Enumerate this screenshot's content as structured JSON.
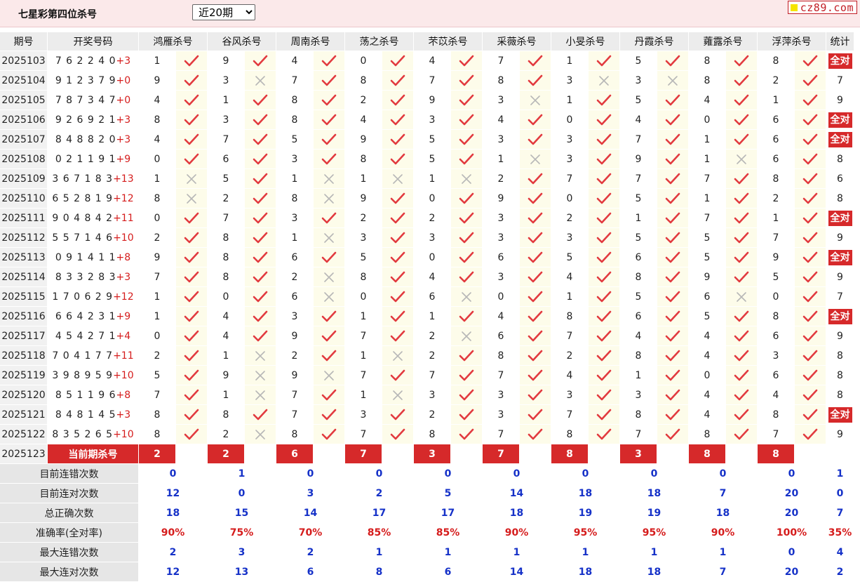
{
  "header": {
    "title": "七星彩第四位杀号",
    "period_select": "近20期",
    "site": "cz89.com"
  },
  "columns": {
    "issue": "期号",
    "draw": "开奖号码",
    "stat": "统计",
    "killers": [
      "鸿雁杀号",
      "谷风杀号",
      "周南杀号",
      "荡之杀号",
      "芣苡杀号",
      "采薇杀号",
      "小旻杀号",
      "丹霞杀号",
      "蕹露杀号",
      "浮萍杀号"
    ]
  },
  "colors": {
    "accent_red": "#d6292a",
    "blue": "#1531c8",
    "tick": "#e23a3f",
    "cross": "#b7b7b7"
  },
  "icons": {
    "correct": "check-icon",
    "wrong": "cross-icon"
  },
  "all_correct_label": "全对",
  "rows": [
    {
      "issue": "2025103",
      "draw": "762240",
      "sum": "+3",
      "kills": [
        1,
        9,
        4,
        0,
        4,
        7,
        1,
        5,
        8,
        8
      ],
      "ok": [
        1,
        1,
        1,
        1,
        1,
        1,
        1,
        1,
        1,
        1
      ],
      "stat": "全对"
    },
    {
      "issue": "2025104",
      "draw": "912379",
      "sum": "+0",
      "kills": [
        9,
        3,
        7,
        8,
        7,
        8,
        3,
        3,
        8,
        2
      ],
      "ok": [
        1,
        0,
        1,
        1,
        1,
        1,
        0,
        0,
        1,
        1
      ],
      "stat": "7"
    },
    {
      "issue": "2025105",
      "draw": "787347",
      "sum": "+0",
      "kills": [
        4,
        1,
        8,
        2,
        9,
        3,
        1,
        5,
        4,
        1
      ],
      "ok": [
        1,
        1,
        1,
        1,
        1,
        0,
        1,
        1,
        1,
        1
      ],
      "stat": "9"
    },
    {
      "issue": "2025106",
      "draw": "926921",
      "sum": "+3",
      "kills": [
        8,
        3,
        8,
        4,
        3,
        4,
        0,
        4,
        0,
        6
      ],
      "ok": [
        1,
        1,
        1,
        1,
        1,
        1,
        1,
        1,
        1,
        1
      ],
      "stat": "全对"
    },
    {
      "issue": "2025107",
      "draw": "848820",
      "sum": "+3",
      "kills": [
        4,
        7,
        5,
        9,
        5,
        3,
        3,
        7,
        1,
        6
      ],
      "ok": [
        1,
        1,
        1,
        1,
        1,
        1,
        1,
        1,
        1,
        1
      ],
      "stat": "全对"
    },
    {
      "issue": "2025108",
      "draw": "021191",
      "sum": "+9",
      "kills": [
        0,
        6,
        3,
        8,
        5,
        1,
        3,
        9,
        1,
        6
      ],
      "ok": [
        1,
        1,
        1,
        1,
        1,
        0,
        1,
        1,
        0,
        1
      ],
      "stat": "8"
    },
    {
      "issue": "2025109",
      "draw": "367183",
      "sum": "+13",
      "kills": [
        1,
        5,
        1,
        1,
        1,
        2,
        7,
        7,
        7,
        8
      ],
      "ok": [
        0,
        1,
        0,
        0,
        0,
        1,
        1,
        1,
        1,
        1
      ],
      "stat": "6"
    },
    {
      "issue": "2025110",
      "draw": "652819",
      "sum": "+12",
      "kills": [
        8,
        2,
        8,
        9,
        0,
        9,
        0,
        5,
        1,
        2
      ],
      "ok": [
        0,
        1,
        0,
        1,
        1,
        1,
        1,
        1,
        1,
        1
      ],
      "stat": "8"
    },
    {
      "issue": "2025111",
      "draw": "904842",
      "sum": "+11",
      "kills": [
        0,
        7,
        3,
        2,
        2,
        3,
        2,
        1,
        7,
        1
      ],
      "ok": [
        1,
        1,
        1,
        1,
        1,
        1,
        1,
        1,
        1,
        1
      ],
      "stat": "全对"
    },
    {
      "issue": "2025112",
      "draw": "557146",
      "sum": "+10",
      "kills": [
        2,
        8,
        1,
        3,
        3,
        3,
        3,
        5,
        5,
        7
      ],
      "ok": [
        1,
        1,
        0,
        1,
        1,
        1,
        1,
        1,
        1,
        1
      ],
      "stat": "9"
    },
    {
      "issue": "2025113",
      "draw": "091411",
      "sum": "+8",
      "kills": [
        9,
        8,
        6,
        5,
        0,
        6,
        5,
        6,
        5,
        9
      ],
      "ok": [
        1,
        1,
        1,
        1,
        1,
        1,
        1,
        1,
        1,
        1
      ],
      "stat": "全对"
    },
    {
      "issue": "2025114",
      "draw": "833283",
      "sum": "+3",
      "kills": [
        7,
        8,
        2,
        8,
        4,
        3,
        4,
        8,
        9,
        5
      ],
      "ok": [
        1,
        1,
        0,
        1,
        1,
        1,
        1,
        1,
        1,
        1
      ],
      "stat": "9"
    },
    {
      "issue": "2025115",
      "draw": "170629",
      "sum": "+12",
      "kills": [
        1,
        0,
        6,
        0,
        6,
        0,
        1,
        5,
        6,
        0
      ],
      "ok": [
        1,
        1,
        0,
        1,
        0,
        1,
        1,
        1,
        0,
        1
      ],
      "stat": "7"
    },
    {
      "issue": "2025116",
      "draw": "664231",
      "sum": "+9",
      "kills": [
        1,
        4,
        3,
        1,
        1,
        4,
        8,
        6,
        5,
        8
      ],
      "ok": [
        1,
        1,
        1,
        1,
        1,
        1,
        1,
        1,
        1,
        1
      ],
      "stat": "全对"
    },
    {
      "issue": "2025117",
      "draw": "454271",
      "sum": "+4",
      "kills": [
        0,
        4,
        9,
        7,
        2,
        6,
        7,
        4,
        4,
        6
      ],
      "ok": [
        1,
        1,
        1,
        1,
        0,
        1,
        1,
        1,
        1,
        1
      ],
      "stat": "9"
    },
    {
      "issue": "2025118",
      "draw": "704177",
      "sum": "+11",
      "kills": [
        2,
        1,
        2,
        1,
        2,
        8,
        2,
        8,
        4,
        3
      ],
      "ok": [
        1,
        0,
        1,
        0,
        1,
        1,
        1,
        1,
        1,
        1
      ],
      "stat": "8"
    },
    {
      "issue": "2025119",
      "draw": "398959",
      "sum": "+10",
      "kills": [
        5,
        9,
        9,
        7,
        7,
        7,
        4,
        1,
        0,
        6
      ],
      "ok": [
        1,
        0,
        0,
        1,
        1,
        1,
        1,
        1,
        1,
        1
      ],
      "stat": "8"
    },
    {
      "issue": "2025120",
      "draw": "851196",
      "sum": "+8",
      "kills": [
        7,
        1,
        7,
        1,
        3,
        3,
        3,
        3,
        4,
        4
      ],
      "ok": [
        1,
        0,
        1,
        0,
        1,
        1,
        1,
        1,
        1,
        1
      ],
      "stat": "8"
    },
    {
      "issue": "2025121",
      "draw": "848145",
      "sum": "+3",
      "kills": [
        8,
        8,
        7,
        3,
        2,
        3,
        7,
        8,
        4,
        8
      ],
      "ok": [
        1,
        1,
        1,
        1,
        1,
        1,
        1,
        1,
        1,
        1
      ],
      "stat": "全对"
    },
    {
      "issue": "2025122",
      "draw": "835265",
      "sum": "+10",
      "kills": [
        8,
        2,
        8,
        7,
        8,
        7,
        8,
        7,
        8,
        7
      ],
      "ok": [
        1,
        0,
        1,
        1,
        1,
        1,
        1,
        1,
        1,
        1
      ],
      "stat": "9"
    }
  ],
  "current": {
    "issue": "2025123",
    "label": "当前期杀号",
    "kills": [
      "2",
      "2",
      "6",
      "7",
      "3",
      "7",
      "8",
      "3",
      "8",
      "8"
    ]
  },
  "stats": [
    {
      "label": "目前连错次数",
      "values": [
        "0",
        "1",
        "0",
        "0",
        "0",
        "0",
        "0",
        "0",
        "0",
        "0"
      ],
      "total": "1",
      "red": false
    },
    {
      "label": "目前连对次数",
      "values": [
        "12",
        "0",
        "3",
        "2",
        "5",
        "14",
        "18",
        "18",
        "7",
        "20"
      ],
      "total": "0",
      "red": false
    },
    {
      "label": "总正确次数",
      "values": [
        "18",
        "15",
        "14",
        "17",
        "17",
        "18",
        "19",
        "19",
        "18",
        "20"
      ],
      "total": "7",
      "red": false
    },
    {
      "label": "准确率(全对率)",
      "values": [
        "90%",
        "75%",
        "70%",
        "85%",
        "85%",
        "90%",
        "95%",
        "95%",
        "90%",
        "100%"
      ],
      "total": "35%",
      "red": true
    },
    {
      "label": "最大连错次数",
      "values": [
        "2",
        "3",
        "2",
        "1",
        "1",
        "1",
        "1",
        "1",
        "1",
        "0"
      ],
      "total": "4",
      "red": false
    },
    {
      "label": "最大连对次数",
      "values": [
        "12",
        "13",
        "6",
        "8",
        "6",
        "14",
        "18",
        "18",
        "7",
        "20"
      ],
      "total": "2",
      "red": false
    }
  ]
}
